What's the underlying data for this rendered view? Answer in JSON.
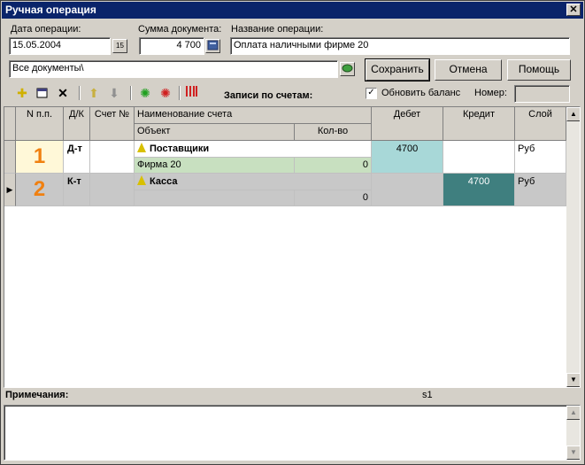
{
  "window": {
    "title": "Ручная операция",
    "close_glyph": "✕"
  },
  "form": {
    "date_label": "Дата операции:",
    "date_value": "15.05.2004",
    "calendar_btn": "15",
    "sum_label": "Сумма документа:",
    "sum_value": "4 700",
    "name_label": "Название операции:",
    "name_value": "Оплата наличными фирме 20",
    "docs_value": "Все документы\\"
  },
  "buttons": {
    "save": "Сохранить",
    "cancel": "Отмена",
    "help": "Помощь"
  },
  "toolbar": {
    "title": "Записи по счетам:",
    "refresh_label": "Обновить баланс",
    "refresh_checked": "✓",
    "number_label": "Номер:",
    "icons": [
      "add-icon",
      "edit-icon",
      "delete-icon",
      "move-up-icon",
      "move-down-icon",
      "green-gear-icon",
      "red-gear-icon",
      "columns-icon"
    ]
  },
  "grid": {
    "headers": {
      "num": "N п.п.",
      "dk": "Д/К",
      "account_no": "Счет №",
      "account_name": "Наименование счета",
      "object": "Объект",
      "qty": "Кол-во",
      "debit": "Дебет",
      "credit": "Кредит",
      "layer": "Слой"
    },
    "rows": [
      {
        "num": "1",
        "dk": "Д-т",
        "account": "Поставщики",
        "object": "Фирма 20",
        "qty": "0",
        "debit": "4700",
        "credit": "",
        "layer": "Руб"
      },
      {
        "num": "2",
        "dk": "К-т",
        "account": "Касса",
        "object": "",
        "qty": "0",
        "debit": "",
        "credit": "4700",
        "layer": "Руб"
      }
    ]
  },
  "notes": {
    "label": "Примечания:",
    "status": "s1"
  },
  "colors": {
    "debit_fill": "#a8d8d8",
    "credit_fill": "#3f7f7f",
    "object_fill": "#c8e0c0",
    "selected_row": "#c8c8c8",
    "title_bar": "#0a246a"
  }
}
